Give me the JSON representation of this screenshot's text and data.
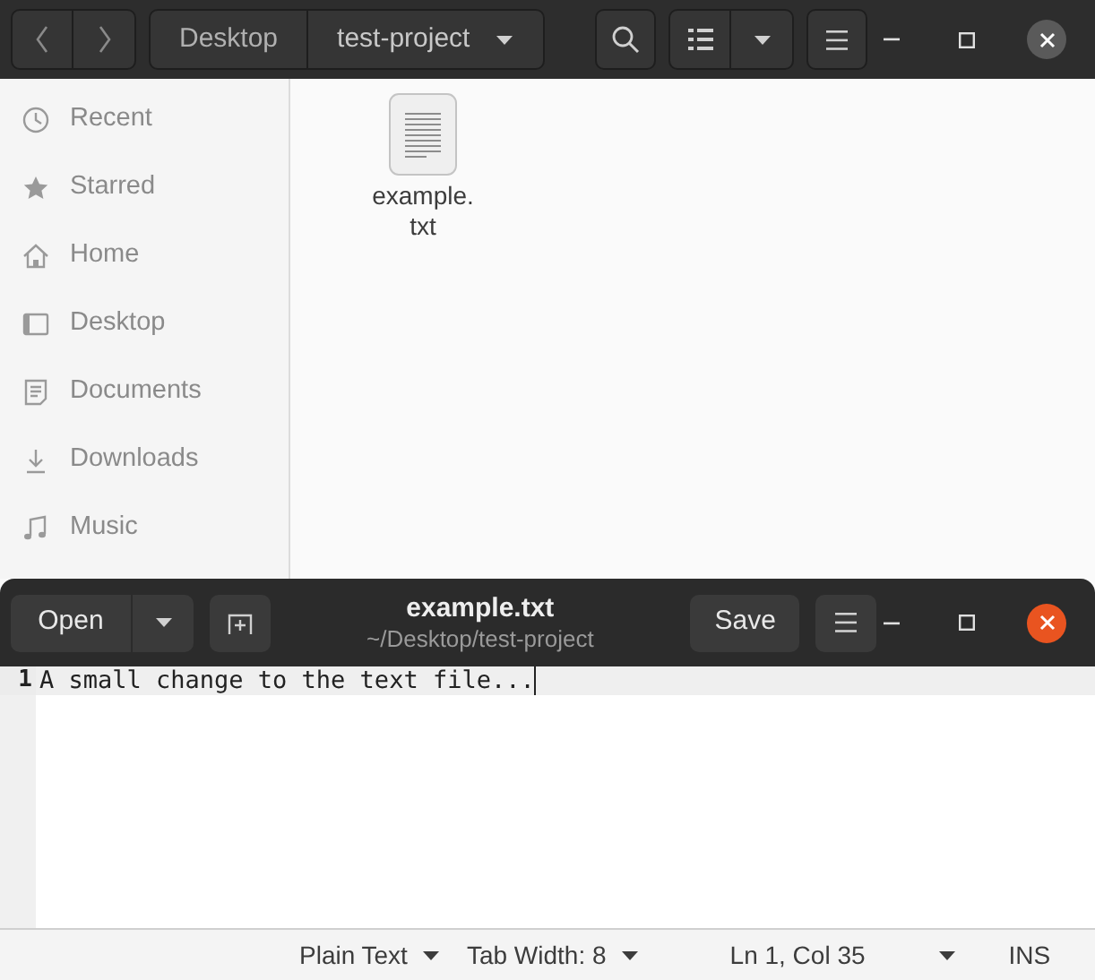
{
  "file_manager": {
    "path_bar": [
      {
        "label": "Desktop",
        "selected": false
      },
      {
        "label": "test-project",
        "selected": true
      }
    ],
    "sidebar": {
      "items": [
        {
          "label": "Recent"
        },
        {
          "label": "Starred"
        },
        {
          "label": "Home"
        },
        {
          "label": "Desktop"
        },
        {
          "label": "Documents"
        },
        {
          "label": "Downloads"
        },
        {
          "label": "Music"
        }
      ]
    },
    "files": [
      {
        "name": "example.\ntxt"
      }
    ]
  },
  "editor": {
    "window": {
      "title": "example.txt",
      "subtitle": "~/Desktop/test-project"
    },
    "buttons": {
      "open": "Open",
      "save": "Save"
    },
    "lines": [
      {
        "number": "1",
        "text": "A small change to the text file..."
      }
    ],
    "status_bar": {
      "language": "Plain Text",
      "tab_width": "Tab Width: 8",
      "position": "Ln 1, Col 35",
      "mode": "INS"
    }
  }
}
